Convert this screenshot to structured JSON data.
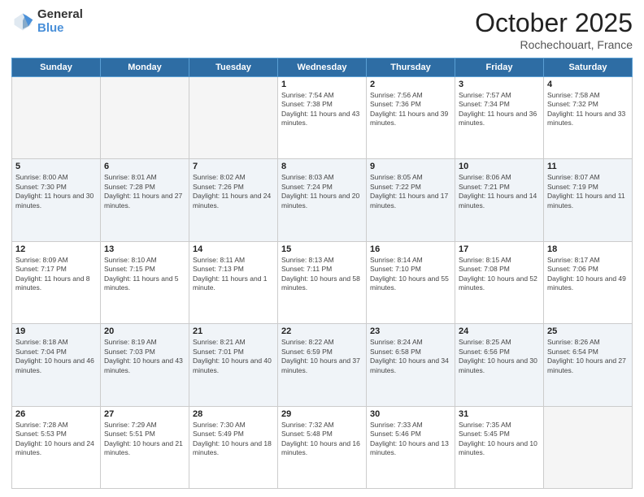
{
  "logo": {
    "general": "General",
    "blue": "Blue"
  },
  "header": {
    "month": "October 2025",
    "location": "Rochechouart, France"
  },
  "weekdays": [
    "Sunday",
    "Monday",
    "Tuesday",
    "Wednesday",
    "Thursday",
    "Friday",
    "Saturday"
  ],
  "weeks": [
    {
      "shaded": false,
      "days": [
        {
          "num": "",
          "info": ""
        },
        {
          "num": "",
          "info": ""
        },
        {
          "num": "",
          "info": ""
        },
        {
          "num": "1",
          "info": "Sunrise: 7:54 AM\nSunset: 7:38 PM\nDaylight: 11 hours and 43 minutes."
        },
        {
          "num": "2",
          "info": "Sunrise: 7:56 AM\nSunset: 7:36 PM\nDaylight: 11 hours and 39 minutes."
        },
        {
          "num": "3",
          "info": "Sunrise: 7:57 AM\nSunset: 7:34 PM\nDaylight: 11 hours and 36 minutes."
        },
        {
          "num": "4",
          "info": "Sunrise: 7:58 AM\nSunset: 7:32 PM\nDaylight: 11 hours and 33 minutes."
        }
      ]
    },
    {
      "shaded": true,
      "days": [
        {
          "num": "5",
          "info": "Sunrise: 8:00 AM\nSunset: 7:30 PM\nDaylight: 11 hours and 30 minutes."
        },
        {
          "num": "6",
          "info": "Sunrise: 8:01 AM\nSunset: 7:28 PM\nDaylight: 11 hours and 27 minutes."
        },
        {
          "num": "7",
          "info": "Sunrise: 8:02 AM\nSunset: 7:26 PM\nDaylight: 11 hours and 24 minutes."
        },
        {
          "num": "8",
          "info": "Sunrise: 8:03 AM\nSunset: 7:24 PM\nDaylight: 11 hours and 20 minutes."
        },
        {
          "num": "9",
          "info": "Sunrise: 8:05 AM\nSunset: 7:22 PM\nDaylight: 11 hours and 17 minutes."
        },
        {
          "num": "10",
          "info": "Sunrise: 8:06 AM\nSunset: 7:21 PM\nDaylight: 11 hours and 14 minutes."
        },
        {
          "num": "11",
          "info": "Sunrise: 8:07 AM\nSunset: 7:19 PM\nDaylight: 11 hours and 11 minutes."
        }
      ]
    },
    {
      "shaded": false,
      "days": [
        {
          "num": "12",
          "info": "Sunrise: 8:09 AM\nSunset: 7:17 PM\nDaylight: 11 hours and 8 minutes."
        },
        {
          "num": "13",
          "info": "Sunrise: 8:10 AM\nSunset: 7:15 PM\nDaylight: 11 hours and 5 minutes."
        },
        {
          "num": "14",
          "info": "Sunrise: 8:11 AM\nSunset: 7:13 PM\nDaylight: 11 hours and 1 minute."
        },
        {
          "num": "15",
          "info": "Sunrise: 8:13 AM\nSunset: 7:11 PM\nDaylight: 10 hours and 58 minutes."
        },
        {
          "num": "16",
          "info": "Sunrise: 8:14 AM\nSunset: 7:10 PM\nDaylight: 10 hours and 55 minutes."
        },
        {
          "num": "17",
          "info": "Sunrise: 8:15 AM\nSunset: 7:08 PM\nDaylight: 10 hours and 52 minutes."
        },
        {
          "num": "18",
          "info": "Sunrise: 8:17 AM\nSunset: 7:06 PM\nDaylight: 10 hours and 49 minutes."
        }
      ]
    },
    {
      "shaded": true,
      "days": [
        {
          "num": "19",
          "info": "Sunrise: 8:18 AM\nSunset: 7:04 PM\nDaylight: 10 hours and 46 minutes."
        },
        {
          "num": "20",
          "info": "Sunrise: 8:19 AM\nSunset: 7:03 PM\nDaylight: 10 hours and 43 minutes."
        },
        {
          "num": "21",
          "info": "Sunrise: 8:21 AM\nSunset: 7:01 PM\nDaylight: 10 hours and 40 minutes."
        },
        {
          "num": "22",
          "info": "Sunrise: 8:22 AM\nSunset: 6:59 PM\nDaylight: 10 hours and 37 minutes."
        },
        {
          "num": "23",
          "info": "Sunrise: 8:24 AM\nSunset: 6:58 PM\nDaylight: 10 hours and 34 minutes."
        },
        {
          "num": "24",
          "info": "Sunrise: 8:25 AM\nSunset: 6:56 PM\nDaylight: 10 hours and 30 minutes."
        },
        {
          "num": "25",
          "info": "Sunrise: 8:26 AM\nSunset: 6:54 PM\nDaylight: 10 hours and 27 minutes."
        }
      ]
    },
    {
      "shaded": false,
      "days": [
        {
          "num": "26",
          "info": "Sunrise: 7:28 AM\nSunset: 5:53 PM\nDaylight: 10 hours and 24 minutes."
        },
        {
          "num": "27",
          "info": "Sunrise: 7:29 AM\nSunset: 5:51 PM\nDaylight: 10 hours and 21 minutes."
        },
        {
          "num": "28",
          "info": "Sunrise: 7:30 AM\nSunset: 5:49 PM\nDaylight: 10 hours and 18 minutes."
        },
        {
          "num": "29",
          "info": "Sunrise: 7:32 AM\nSunset: 5:48 PM\nDaylight: 10 hours and 16 minutes."
        },
        {
          "num": "30",
          "info": "Sunrise: 7:33 AM\nSunset: 5:46 PM\nDaylight: 10 hours and 13 minutes."
        },
        {
          "num": "31",
          "info": "Sunrise: 7:35 AM\nSunset: 5:45 PM\nDaylight: 10 hours and 10 minutes."
        },
        {
          "num": "",
          "info": ""
        }
      ]
    }
  ]
}
